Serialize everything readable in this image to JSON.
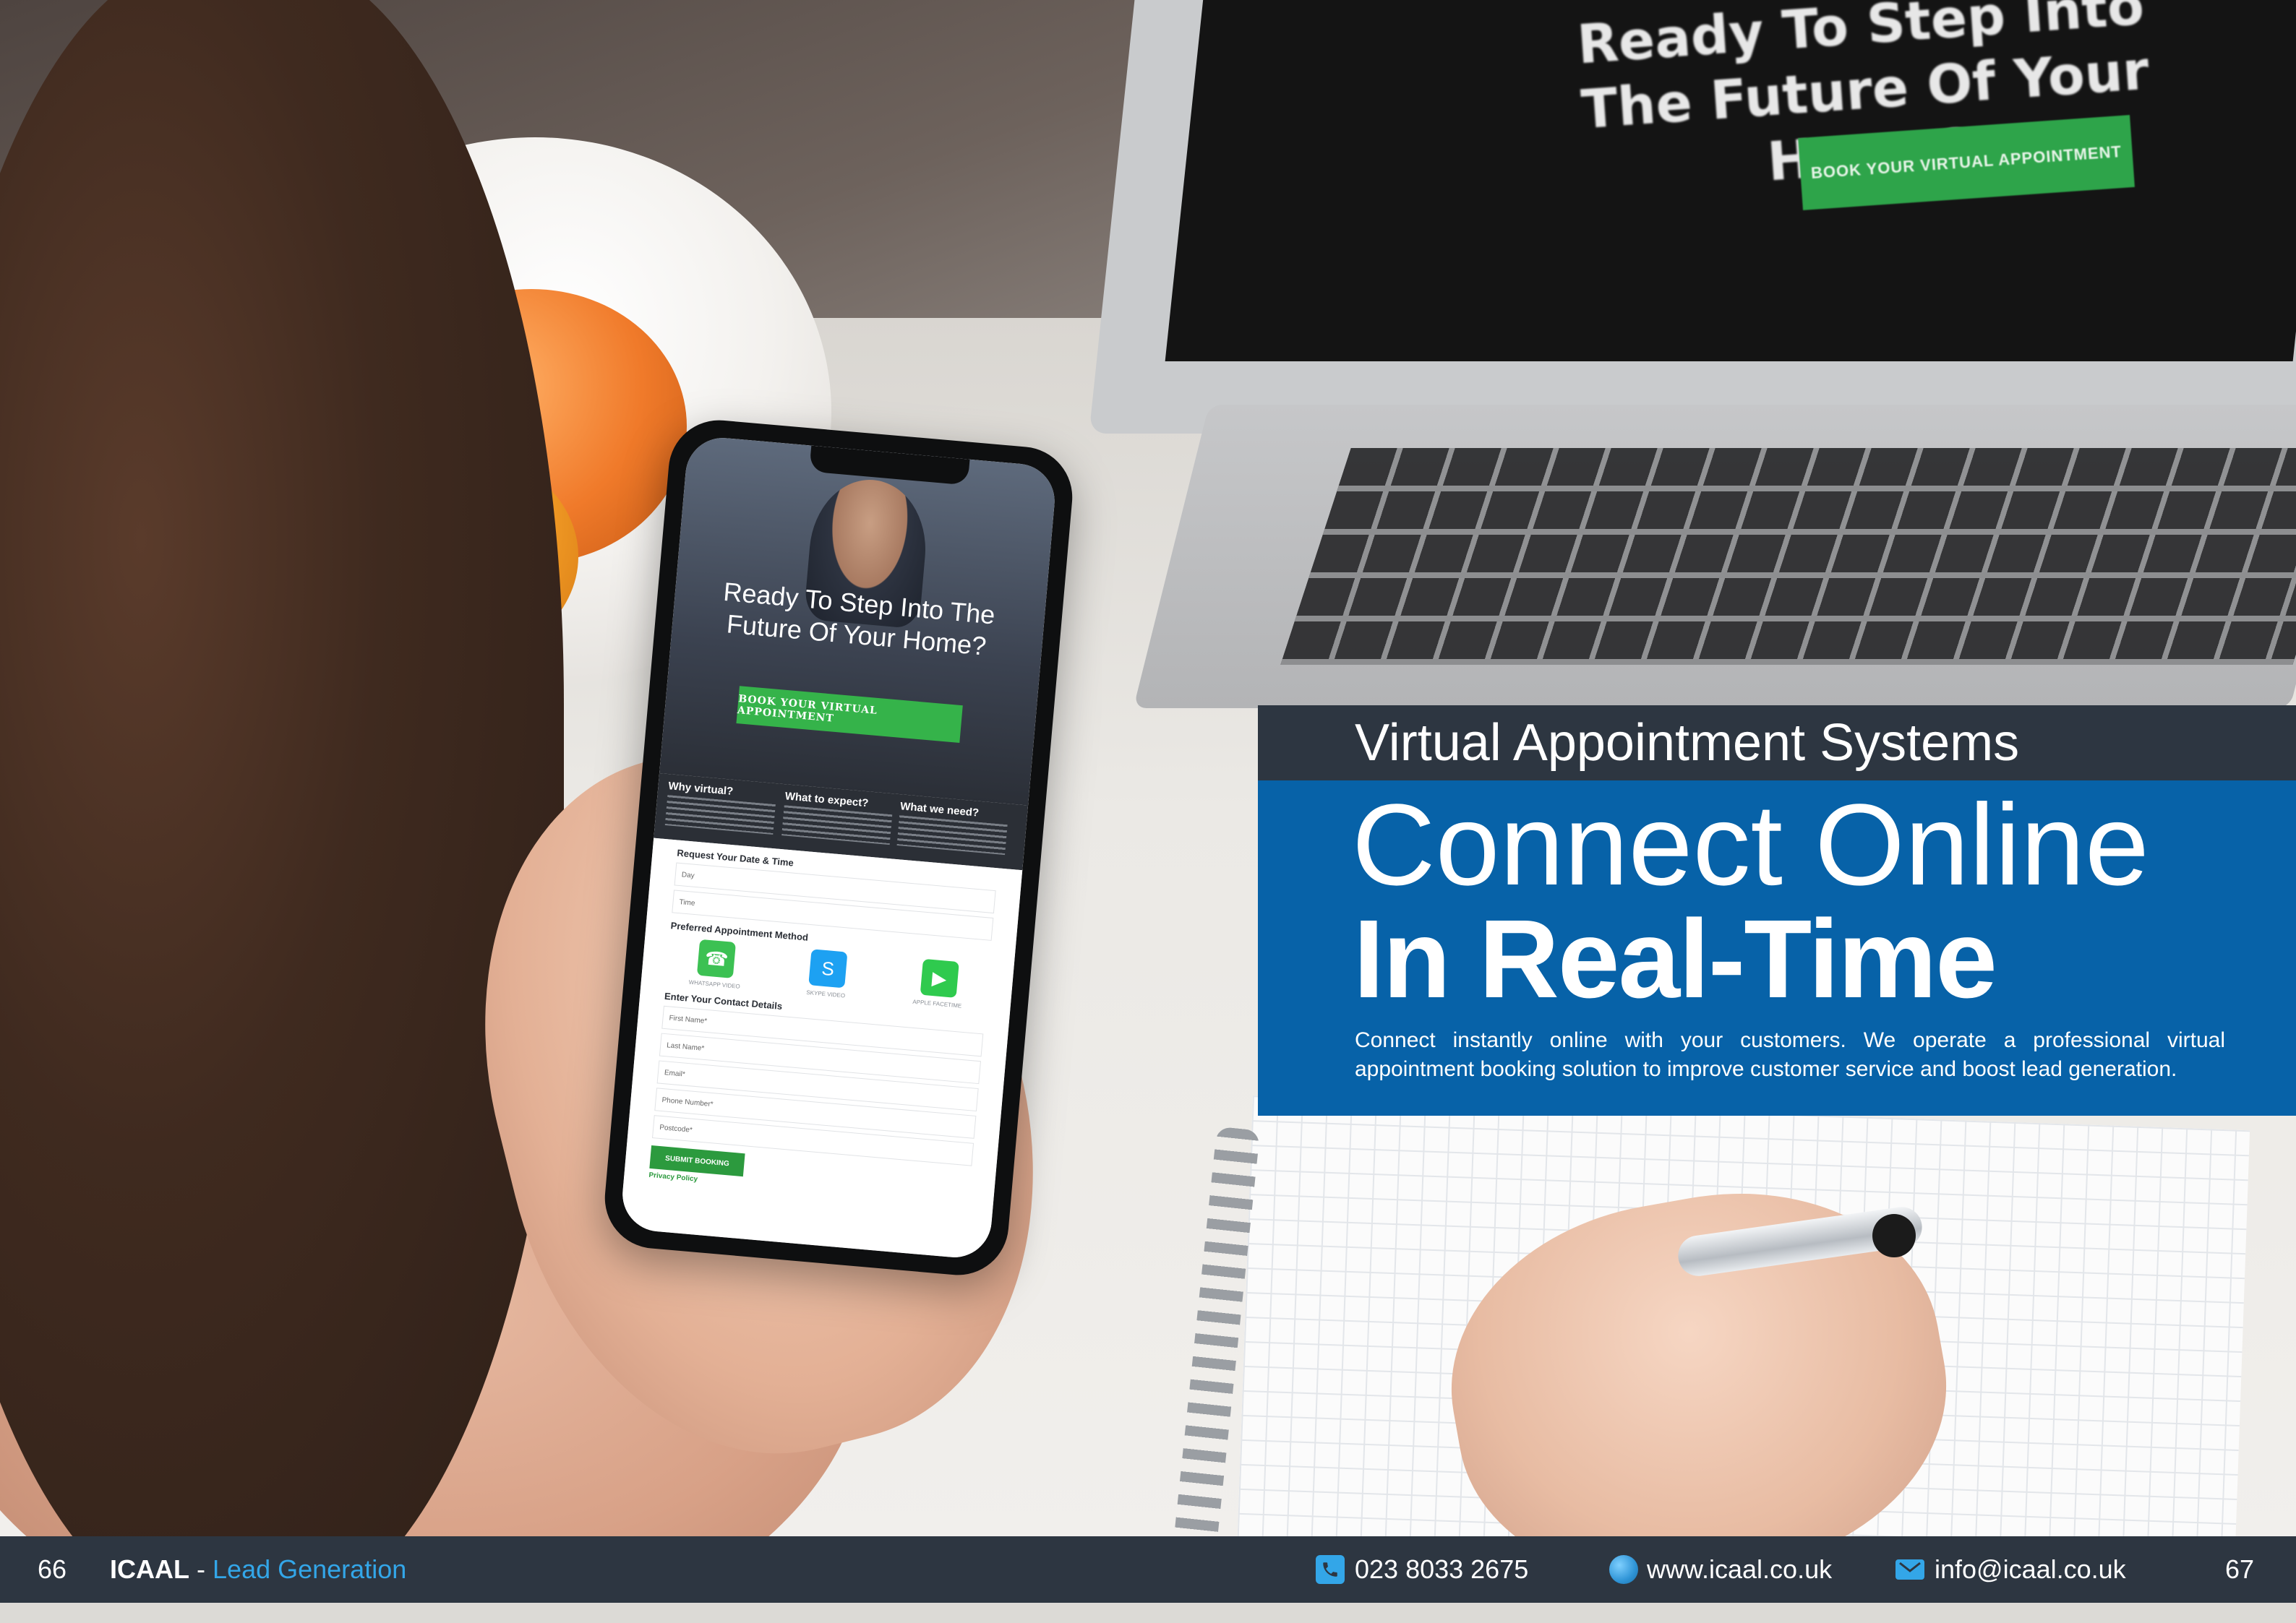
{
  "laptop_screen": {
    "headline": "Ready To Step Into The Future Of Your Home?",
    "button": "BOOK YOUR VIRTUAL APPOINTMENT"
  },
  "phone_screen": {
    "hero_title": "Ready To Step Into The Future Of Your Home?",
    "hero_button": "BOOK YOUR VIRTUAL APPOINTMENT",
    "info_columns": [
      "Why virtual?",
      "What to expect?",
      "What we need?"
    ],
    "request_heading": "Request Your Date & Time",
    "fields_datetime": [
      "Day",
      "Time"
    ],
    "method_heading": "Preferred Appointment Method",
    "methods": [
      {
        "label": "WHATSAPP VIDEO",
        "icon": "whatsapp-icon",
        "color": "#3cc153"
      },
      {
        "label": "SKYPE VIDEO",
        "icon": "skype-icon",
        "color": "#1da1f2"
      },
      {
        "label": "APPLE FACETIME",
        "icon": "facetime-icon",
        "color": "#2fca4e"
      }
    ],
    "contact_heading": "Enter Your Contact Details",
    "fields_contact": [
      "First Name*",
      "Last Name*",
      "Email*",
      "Phone Number*",
      "Postcode*"
    ],
    "submit_button": "SUBMIT BOOKING",
    "privacy_link": "Privacy Policy"
  },
  "panel": {
    "subtitle": "Virtual Appointment Systems",
    "headline_line1": "Connect Online",
    "headline_line2": "In Real-Time",
    "intro": "Connect instantly online with your customers. We operate a professional virtual appointment booking solution to improve customer service and boost lead generation."
  },
  "footer": {
    "page_left": "66",
    "brand": "ICAAL",
    "separator": "-",
    "section": "Lead Generation",
    "phone": "023 8033 2675",
    "website": "www.icaal.co.uk",
    "email": "info@icaal.co.uk",
    "page_right": "67"
  },
  "colors": {
    "panel_blue": "#0762a8",
    "dark_slate": "#2d3641",
    "accent_blue": "#33a6e8",
    "button_green": "#35b34a"
  }
}
